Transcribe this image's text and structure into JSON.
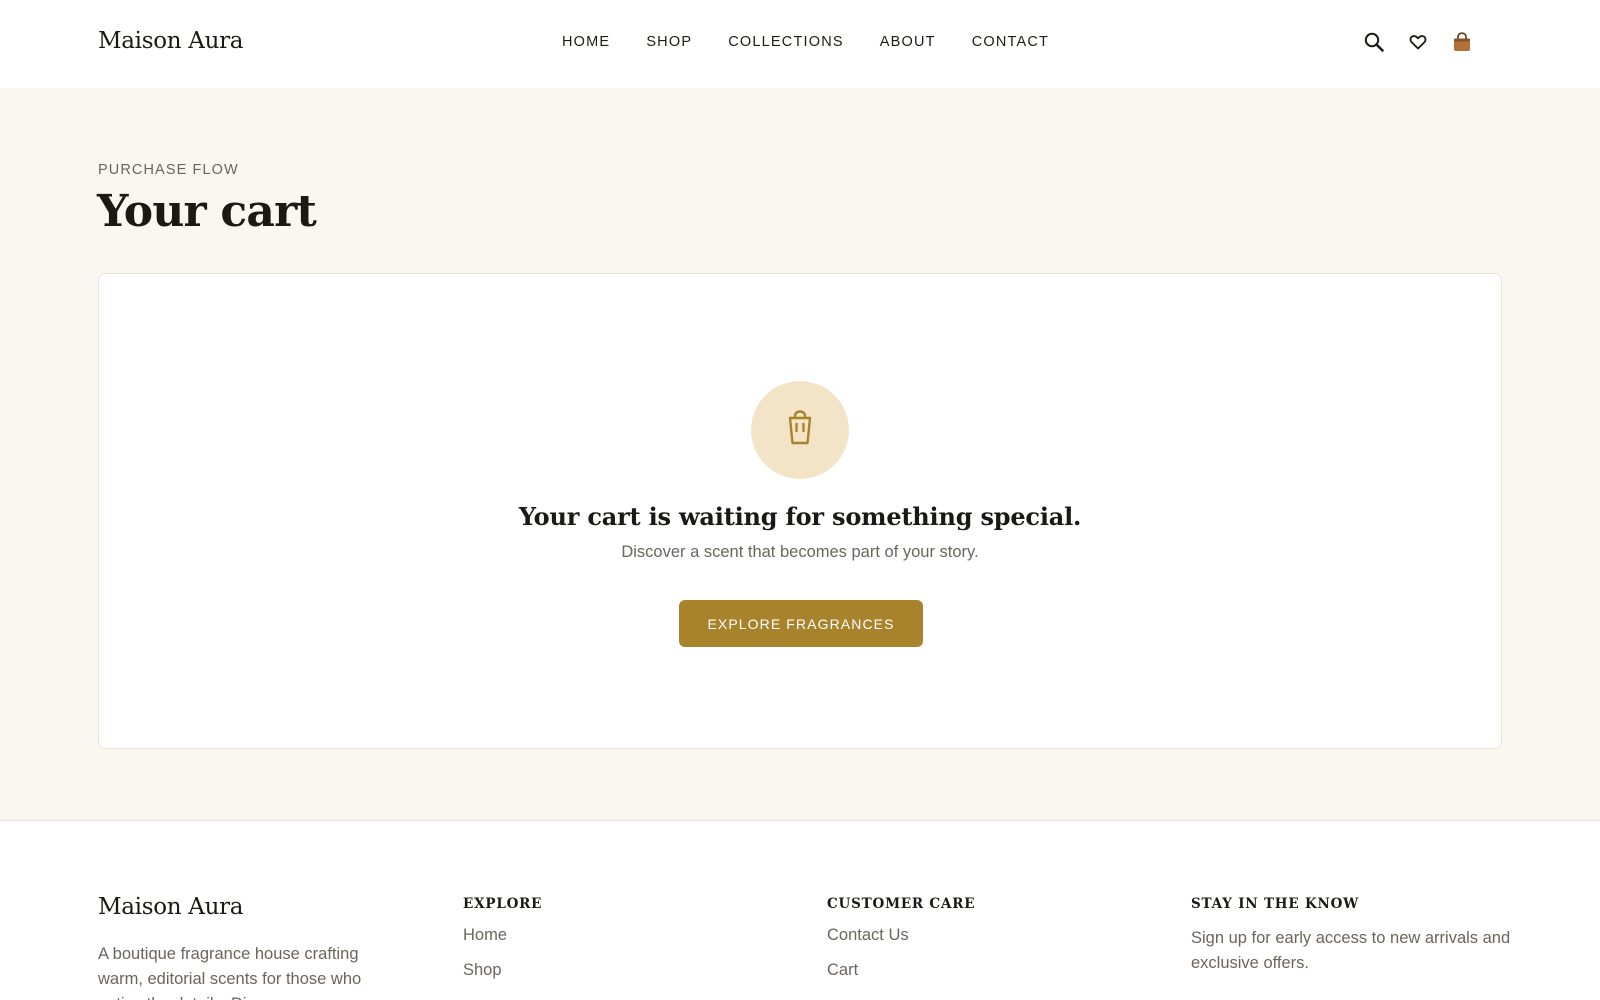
{
  "header": {
    "brand": "Maison Aura",
    "nav": [
      "HOME",
      "SHOP",
      "COLLECTIONS",
      "ABOUT",
      "CONTACT"
    ],
    "icons": [
      "search-icon",
      "heart-icon",
      "shopping-bag-icon"
    ]
  },
  "main": {
    "eyebrow": "PURCHASE FLOW",
    "title": "Your cart",
    "empty_state": {
      "icon": "shopping-bag-icon",
      "title": "Your cart is waiting for something special.",
      "subtitle": "Discover a scent that becomes part of your story.",
      "cta_label": "EXPLORE FRAGRANCES"
    }
  },
  "footer": {
    "brand": "Maison Aura",
    "description": "A boutique fragrance house crafting warm, editorial scents for those who notice the details. Di",
    "columns": [
      {
        "heading": "EXPLORE",
        "links": [
          "Home",
          "Shop"
        ]
      },
      {
        "heading": "CUSTOMER CARE",
        "links": [
          "Contact Us",
          "Cart"
        ]
      }
    ],
    "newsletter": {
      "heading": "STAY IN THE KNOW",
      "text": "Sign up for early access to new arrivals and exclusive offers."
    }
  },
  "colors": {
    "accent": "#a8832b",
    "badge_bg": "#f3e4c8",
    "page_bg": "#faf7f1",
    "text_dark": "#1c1915",
    "text_muted": "#6b655c"
  }
}
